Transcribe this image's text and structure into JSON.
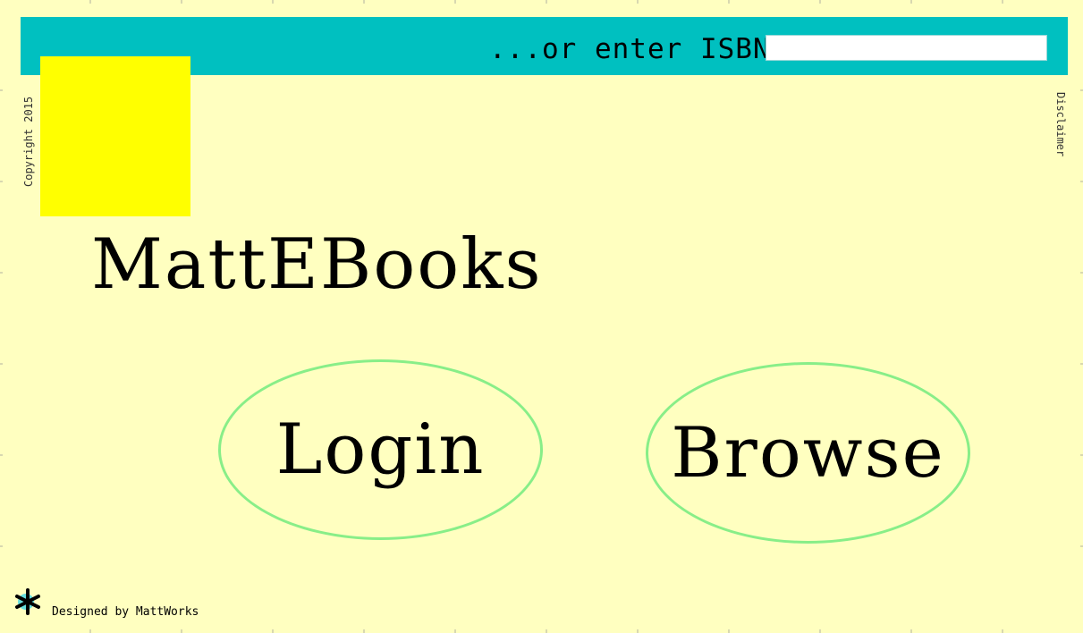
{
  "header": {
    "isbn_label": "...or enter ISBN:",
    "isbn_value": "",
    "isbn_placeholder": ""
  },
  "sidebar": {
    "copyright": "Copyright 2015",
    "disclaimer": "Disclaimer"
  },
  "main": {
    "site_title": "MattEBooks",
    "login_label": "Login",
    "browse_label": "Browse"
  },
  "footer": {
    "credit": "Designed by MattWorks",
    "mark_icon": "asterisk-icon"
  },
  "colors": {
    "background": "#ffffc0",
    "top_bar": "#00c0c0",
    "logo_square": "#ffff00",
    "button_border": "#88ee88"
  }
}
